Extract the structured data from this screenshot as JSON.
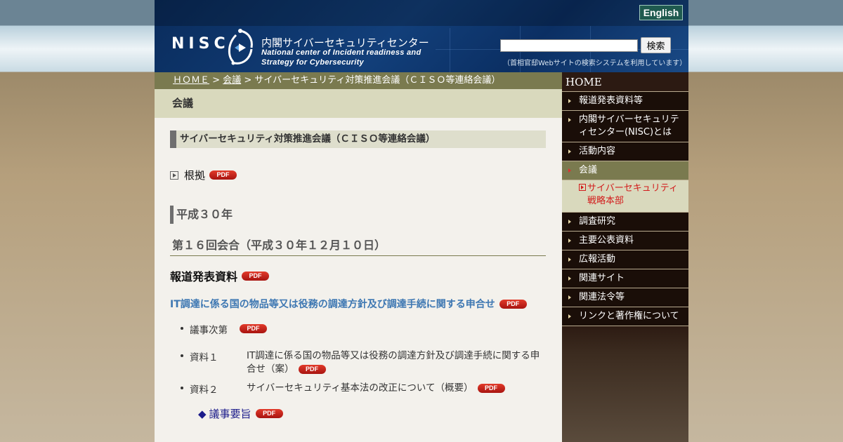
{
  "header": {
    "english_label": "English",
    "logo_text": "NISC",
    "logo_jp": "内閣サイバーセキュリティセンター",
    "logo_en_line1": "National center of Incident readiness and",
    "logo_en_line2": "Strategy for Cybersecurity",
    "search_value": "",
    "search_button": "検索",
    "search_note": "（首相官邸Webサイトの検索システムを利用しています）"
  },
  "breadcrumb": {
    "home": "ＨＯＭＥ",
    "sep1": " > ",
    "meetings": "会議",
    "sep2": " > ",
    "current": "サイバーセキュリティ対策推進会議（ＣＩＳＯ等連絡会議）"
  },
  "section_title": "会議",
  "content": {
    "page_heading": "サイバーセキュリティ対策推進会議（ＣＩＳＯ等連絡会議）",
    "konkyo": "根拠",
    "year_heading": "平成３０年",
    "meeting_heading": "第１６回会合（平成３０年１２月１０日）",
    "press_heading": "報道発表資料",
    "decision_title": "IT調達に係る国の物品等又は役務の調達方針及び調達手続に関する申合せ",
    "documents": [
      {
        "label": "議事次第",
        "text": ""
      },
      {
        "label": "資料１",
        "text": "IT調達に係る国の物品等又は役務の調達方針及び調達手続に関する申合せ（案）"
      },
      {
        "label": "資料２",
        "text": "サイバーセキュリティ基本法の改正について（概要）"
      }
    ],
    "giji_symbol": "◆",
    "giji": "議事要旨",
    "pdf_label": "PDF"
  },
  "sidebar": {
    "home": "HOME",
    "items": [
      "報道発表資料等",
      "内閣サイバーセキュリティセンター(NISC)とは",
      "活動内容",
      "会議",
      "調査研究",
      "主要公表資料",
      "広報活動",
      "関連サイト",
      "関連法令等",
      "リンクと著作権について"
    ],
    "sub_item": "サイバーセキュリティ戦略本部"
  },
  "colors": {
    "header_blue": "#123f7a",
    "breadcrumb_olive": "#7a7a4f",
    "section_khaki": "#d9d9bd",
    "sidebar_dark": "#1a0e08",
    "link_blue": "#3d77b2",
    "active_red": "#d21b1b"
  }
}
